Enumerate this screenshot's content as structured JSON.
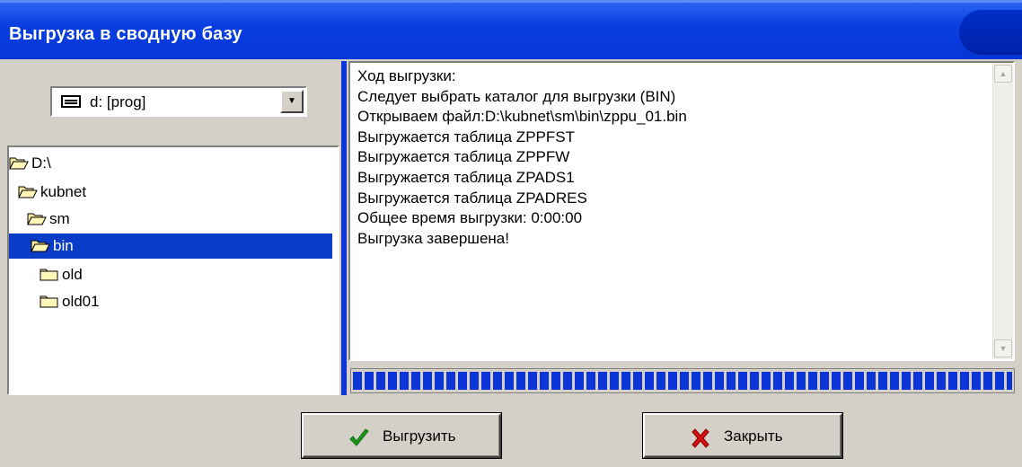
{
  "window": {
    "title": "Выгрузка в сводную базу"
  },
  "drive": {
    "label": "d: [prog]"
  },
  "tree": {
    "items": [
      {
        "label": "D:\\",
        "state": "open"
      },
      {
        "label": "kubnet",
        "state": "open"
      },
      {
        "label": "sm",
        "state": "open"
      },
      {
        "label": "bin",
        "state": "open-selected"
      },
      {
        "label": "old",
        "state": "closed"
      },
      {
        "label": "old01",
        "state": "closed"
      }
    ]
  },
  "log": {
    "lines": [
      "Ход выгрузки:",
      "Следует выбрать каталог для выгрузки (BIN)",
      "Открываем файл:D:\\kubnet\\sm\\bin\\zppu_01.bin",
      "Выгружается таблица ZPPFST",
      "Выгружается таблица ZPPFW",
      "Выгружается таблица ZPADS1",
      "Выгружается таблица ZPADRES",
      "Общее время выгрузки: 0:00:00",
      "Выгрузка завершена!"
    ]
  },
  "progress": {
    "value": 1.0
  },
  "buttons": {
    "export_label": "Выгрузить",
    "close_label": "Закрыть"
  },
  "icons": {
    "drive": "drive-icon",
    "folder_open": "folder-open-icon",
    "folder_closed": "folder-icon",
    "export": "checkmark-icon",
    "close": "red-x-icon"
  },
  "colors": {
    "titlebar": "#0a3ee0",
    "selection": "#0a3cc8",
    "progress": "#0c35d8",
    "checkmark": "#1a9a1a",
    "close_x": "#d41010"
  }
}
